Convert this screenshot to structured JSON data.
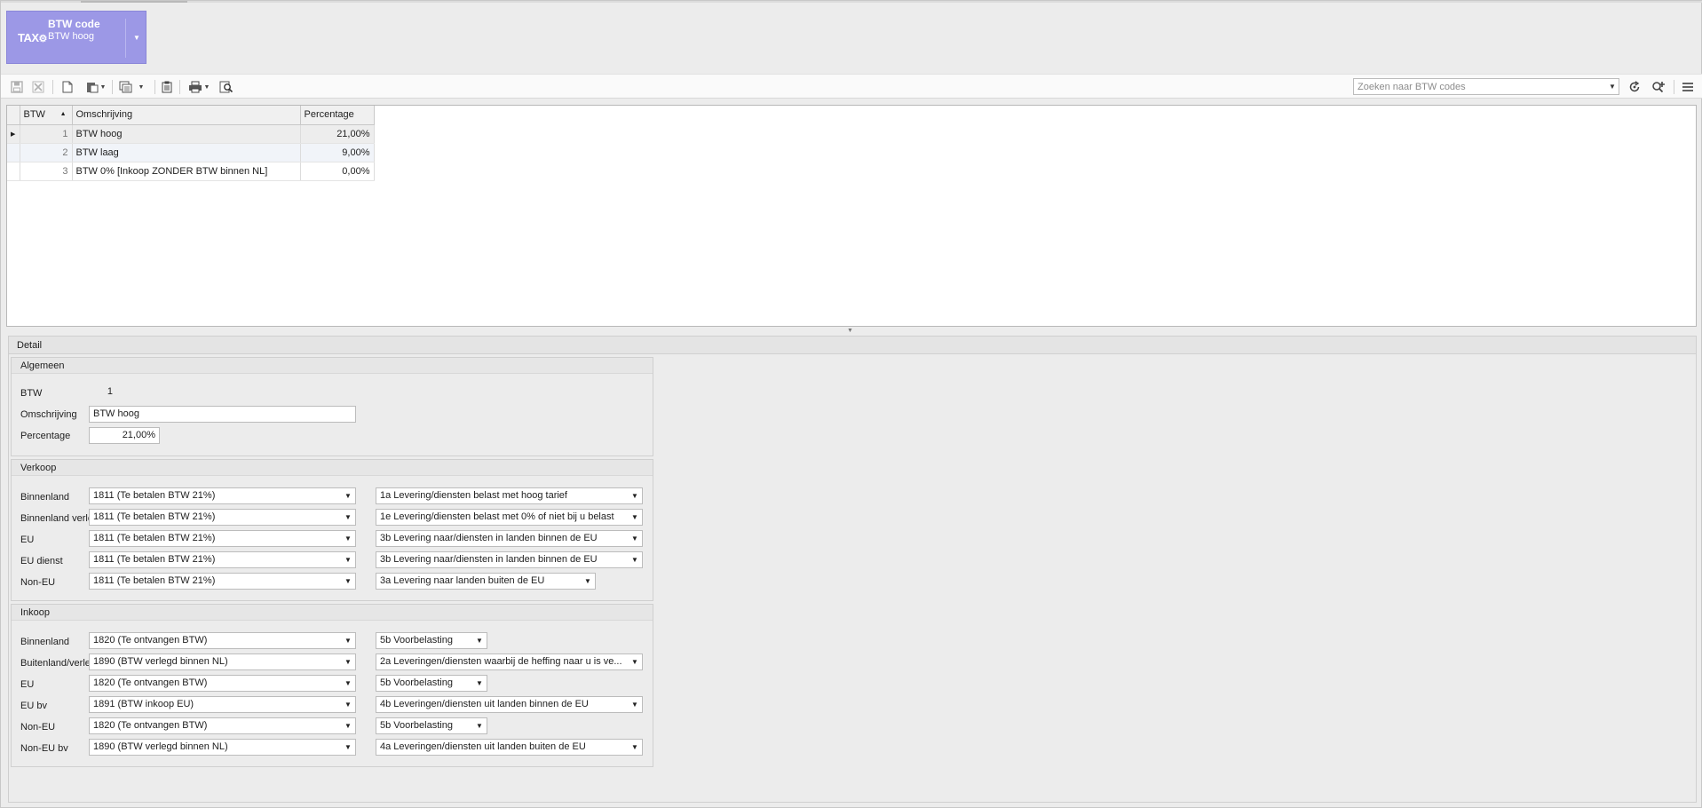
{
  "header": {
    "logo_text": "TAX",
    "title": "BTW code",
    "subtitle": "BTW hoog"
  },
  "toolbar": {
    "icons": [
      "save-icon",
      "delete-icon",
      "new-document-icon",
      "paste-icon",
      "copy-icon",
      "clipboard-icon",
      "print-icon",
      "preview-icon"
    ],
    "search_placeholder": "Zoeken naar BTW codes",
    "right_icons": [
      "refresh-icon",
      "add-search-icon",
      "menu-icon"
    ]
  },
  "grid": {
    "columns": [
      "BTW",
      "Omschrijving",
      "Percentage"
    ],
    "rows": [
      {
        "btw": "1",
        "omschrijving": "BTW hoog",
        "percentage": "21,00%"
      },
      {
        "btw": "2",
        "omschrijving": "BTW laag",
        "percentage": "9,00%"
      },
      {
        "btw": "3",
        "omschrijving": "BTW 0% [Inkoop ZONDER BTW binnen NL]",
        "percentage": "0,00%"
      }
    ]
  },
  "detail": {
    "tab_label": "Detail",
    "algemeen": {
      "title": "Algemeen",
      "btw_label": "BTW",
      "btw_value": "1",
      "omschrijving_label": "Omschrijving",
      "omschrijving_value": "BTW hoog",
      "percentage_label": "Percentage",
      "percentage_value": "21,00%"
    },
    "verkoop": {
      "title": "Verkoop",
      "rows": [
        {
          "label": "Binnenland",
          "account": "1811 (Te betalen BTW 21%)",
          "rubric": "1a Levering/diensten belast met hoog tarief"
        },
        {
          "label": "Binnenland verlegd",
          "account": "1811 (Te betalen BTW 21%)",
          "rubric": "1e Levering/diensten belast met 0% of niet bij u belast"
        },
        {
          "label": "EU",
          "account": "1811 (Te betalen BTW 21%)",
          "rubric": "3b Levering naar/diensten in landen binnen de EU"
        },
        {
          "label": "EU dienst",
          "account": "1811 (Te betalen BTW 21%)",
          "rubric": "3b Levering naar/diensten in landen binnen de EU"
        },
        {
          "label": "Non-EU",
          "account": "1811 (Te betalen BTW 21%)",
          "rubric": "3a Levering naar landen buiten de EU"
        }
      ]
    },
    "inkoop": {
      "title": "Inkoop",
      "rows": [
        {
          "label": "Binnenland",
          "account": "1820 (Te ontvangen BTW)",
          "rubric": "5b Voorbelasting"
        },
        {
          "label": "Buitenland/verlegd",
          "account": "1890 (BTW verlegd binnen NL)",
          "rubric": "2a Leveringen/diensten waarbij de heffing naar u is ve..."
        },
        {
          "label": "EU",
          "account": "1820 (Te ontvangen BTW)",
          "rubric": "5b Voorbelasting"
        },
        {
          "label": "EU bv",
          "account": "1891 (BTW inkoop EU)",
          "rubric": "4b Leveringen/diensten uit landen binnen de EU"
        },
        {
          "label": "Non-EU",
          "account": "1820 (Te ontvangen BTW)",
          "rubric": "5b Voorbelasting"
        },
        {
          "label": "Non-EU bv",
          "account": "1890 (BTW verlegd binnen NL)",
          "rubric": "4a Leveringen/diensten uit landen buiten de EU"
        }
      ]
    }
  },
  "colors": {
    "tile_background": "#9c98e6",
    "selected_row": "#ededed",
    "alt_row": "#f1f4f9"
  }
}
